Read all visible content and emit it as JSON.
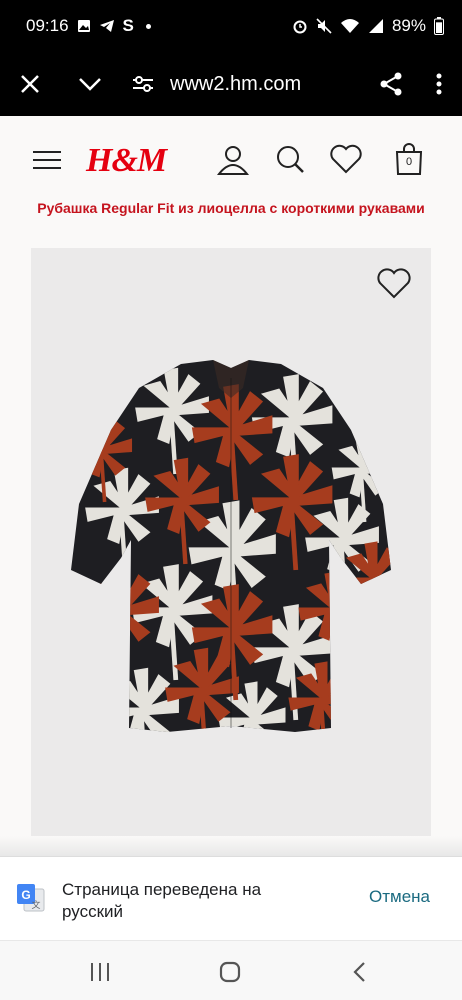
{
  "status_bar": {
    "time": "09:16",
    "battery": "89%",
    "battery_level": 0.89
  },
  "browser": {
    "url": "www2.hm.com"
  },
  "site": {
    "logo": "H&M",
    "cart_count": "0"
  },
  "product": {
    "title": "Рубашка Regular Fit из лиоцелла с короткими рукавами"
  },
  "translate_bar": {
    "message": "Страница переведена на русский",
    "cancel_label": "Отмена"
  },
  "colors": {
    "brand": "#e50010",
    "title": "#c5141e",
    "cancel": "#1a6a80",
    "shirt_bg": "#1e1e22",
    "leaf_rust": "#a63c1e",
    "leaf_cream": "#e4e2dc"
  }
}
